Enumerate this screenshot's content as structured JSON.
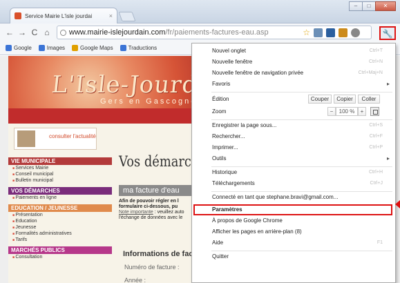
{
  "tab": {
    "title": "Service Mairie L'isle jourdai",
    "close": "×"
  },
  "window": {
    "min": "–",
    "max": "□",
    "close": "✕"
  },
  "toolbar": {
    "back": "←",
    "forward": "→",
    "reload": "C",
    "home": "⌂",
    "url_host": "www.mairie-islejourdain.com",
    "url_path": "/fr/paiements-factures-eau.asp",
    "star": "☆",
    "wrench": "🔧"
  },
  "bookmarks": [
    {
      "label": "Google",
      "icon": "google-icon",
      "color": "#3b74d6"
    },
    {
      "label": "Images",
      "icon": "google-images-icon",
      "color": "#3b74d6"
    },
    {
      "label": "Google Maps",
      "icon": "maps-icon",
      "color": "#e0a000"
    },
    {
      "label": "Traductions",
      "icon": "translate-icon",
      "color": "#3b74d6"
    }
  ],
  "site": {
    "logo": "L'Isle-Jourdain",
    "logo_sub": "Gers en Gascogne",
    "consulter": "consulter l'actualité",
    "menu": [
      {
        "head": "Vie municipale",
        "style": "red",
        "items": [
          "Services Mairie",
          "Conseil municipal",
          "Bulletin municipal"
        ]
      },
      {
        "head": "Vos démarches",
        "style": "purple",
        "items": [
          "Paiements en ligne"
        ]
      },
      {
        "head": "Education / Jeunesse",
        "style": "orange",
        "items": [
          "Présentation",
          "Education",
          "Jeunesse",
          "Formalités administratives",
          "Tarifs"
        ]
      },
      {
        "head": "Marchés publics",
        "style": "mag",
        "items": [
          "Consultation"
        ]
      }
    ],
    "main_title": "Vos démarch",
    "invoice_band": "ma facture d'eau",
    "intro_bold1": "Afin de pouvoir régler en l",
    "intro_bold2": "formulaire ci-dessous, pu",
    "intro_note": "Note importante",
    "intro_rest": " : veuillez auto",
    "intro_line4": "l'échange de données avec le",
    "info_title": "Informations de fact",
    "field1": "Numéro de facture :",
    "field2": "Année :",
    "field_sep": "-"
  },
  "menu": {
    "new_tab": "Nouvel onglet",
    "new_tab_sc": "Ctrl+T",
    "new_window": "Nouvelle fenêtre",
    "new_window_sc": "Ctrl+N",
    "incognito": "Nouvelle fenêtre de navigation privée",
    "incognito_sc": "Ctrl+Maj+N",
    "favoris": "Favoris",
    "edition": "Édition",
    "cut": "Couper",
    "copy": "Copier",
    "paste": "Coller",
    "zoom": "Zoom",
    "zoom_minus": "−",
    "zoom_value": "100 %",
    "zoom_plus": "+",
    "save_page": "Enregistrer la page sous...",
    "save_page_sc": "Ctrl+S",
    "find": "Rechercher...",
    "find_sc": "Ctrl+F",
    "print": "Imprimer...",
    "print_sc": "Ctrl+P",
    "tools": "Outils",
    "history": "Historique",
    "history_sc": "Ctrl+H",
    "downloads": "Téléchargements",
    "downloads_sc": "Ctrl+J",
    "signed_in": "Connecté en tant que stephane.bravi@gmail.com...",
    "settings": "Paramètres",
    "about": "À propos de Google Chrome",
    "background": "Afficher les pages en arrière-plan (8)",
    "help": "Aide",
    "help_sc": "F1",
    "quit": "Quitter",
    "submenu_arrow": "▸"
  },
  "colors": {
    "highlight_border": "#dd1111",
    "header_red": "#c12c2c"
  }
}
